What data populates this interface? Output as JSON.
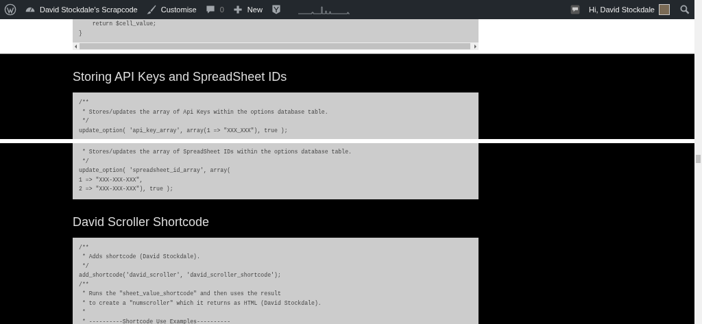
{
  "admin_bar": {
    "site_name": "David Stockdale's Scrapcode",
    "customise": "Customise",
    "comments_count": "0",
    "new_label": "New",
    "greeting": "Hi, David Stockdale"
  },
  "top_code": {
    "lines": [
      "    return $cell_value;",
      "}"
    ]
  },
  "sections": [
    {
      "heading": "Storing API Keys and SpreadSheet IDs",
      "code_before_gap": [
        "/**",
        " * Stores/updates the array of Api Keys within the options database table.",
        " */",
        "update_option( 'api_key_array', array(1 => \"XXX_XXX\"), true );"
      ],
      "code_after_gap": [
        " * Stores/updates the array of SpreadSheet IDs within the options database table.",
        " */",
        "update_option( 'spreadsheet_id_array', array(",
        "1 => \"XXX-XXX-XXX\",",
        "2 => \"XXX-XXX-XXX\"), true );"
      ]
    },
    {
      "heading": "David Scroller Shortcode",
      "code_before_gap": [
        "/**",
        " * Adds shortcode (David Stockdale).",
        " */",
        "add_shortcode('david_scroller', 'david_scroller_shortcode');",
        "/**",
        " * Runs the \"sheet_value_shortcode\" and then uses the result",
        " * to create a \"numscroller\" which it returns as HTML (David Stockdale).",
        " *",
        " * ----------Shortcode Use Examples----------"
      ]
    }
  ]
}
